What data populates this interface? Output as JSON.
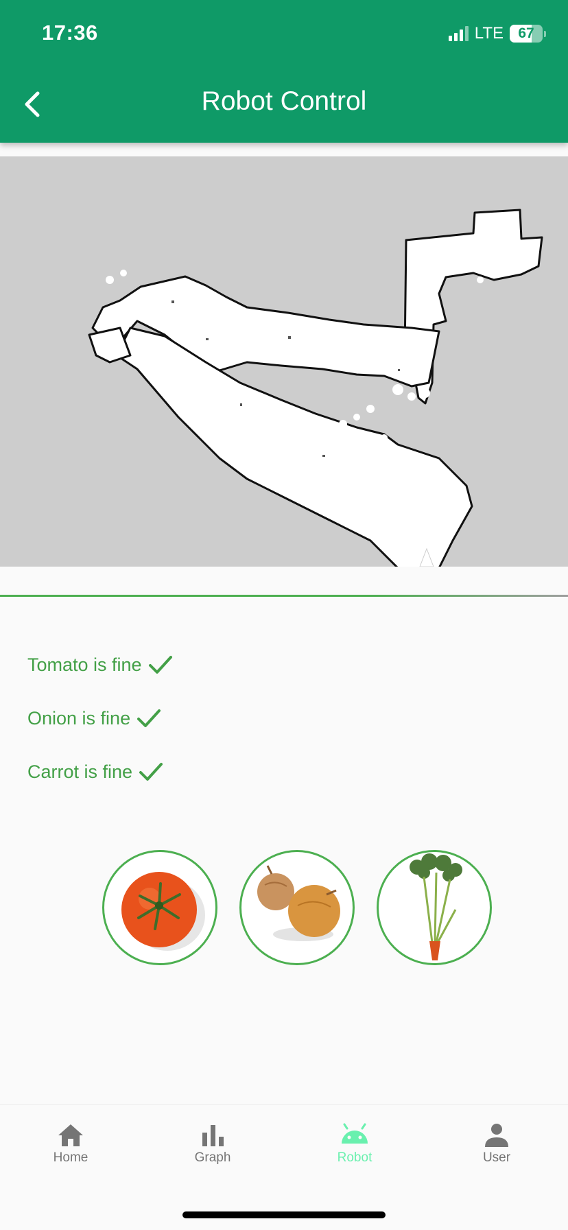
{
  "status_bar": {
    "time": "17:36",
    "network": "LTE",
    "battery": "67",
    "battery_level": 0.67
  },
  "header": {
    "title": "Robot Control",
    "back_icon": "chevron-left-icon",
    "background": "#0f9a67"
  },
  "map": {
    "icon": "occupancy-grid-map"
  },
  "status_items": [
    {
      "label": "Tomato is fine",
      "icon": "check-icon"
    },
    {
      "label": "Onion is fine",
      "icon": "check-icon"
    },
    {
      "label": "Carrot is fine",
      "icon": "check-icon"
    }
  ],
  "vegetables": [
    {
      "icon": "tomato-image"
    },
    {
      "icon": "onion-image"
    },
    {
      "icon": "carrot-image"
    }
  ],
  "bottom_nav": {
    "items": [
      {
        "label": "Home",
        "icon": "home-icon"
      },
      {
        "label": "Graph",
        "icon": "bar-chart-icon"
      },
      {
        "label": "Robot",
        "icon": "android-icon",
        "active": true
      },
      {
        "label": "User",
        "icon": "person-icon"
      }
    ]
  },
  "colors": {
    "accent_green": "#43a047",
    "active_nav": "#69f0ae",
    "inactive_nav": "#757575"
  }
}
